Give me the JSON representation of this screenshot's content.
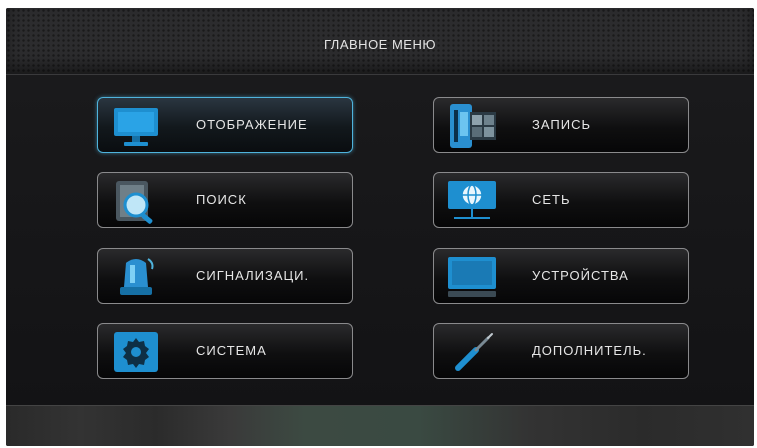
{
  "header": {
    "title": "ГЛАВНОЕ МЕНЮ"
  },
  "menu": {
    "items": [
      {
        "label": "ОТОБРАЖЕНИЕ",
        "icon": "monitor-icon",
        "selected": true
      },
      {
        "label": "ЗАПИСЬ",
        "icon": "film-icon",
        "selected": false
      },
      {
        "label": "ПОИСК",
        "icon": "magnifier-icon",
        "selected": false
      },
      {
        "label": "СЕТЬ",
        "icon": "network-globe-icon",
        "selected": false
      },
      {
        "label": "СИГНАЛИЗАЦИ.",
        "icon": "alarm-beacon-icon",
        "selected": false
      },
      {
        "label": "УСТРОЙСТВА",
        "icon": "device-monitor-icon",
        "selected": false
      },
      {
        "label": "СИСТЕМА",
        "icon": "gear-icon",
        "selected": false
      },
      {
        "label": "ДОПОЛНИТЕЛЬ.",
        "icon": "screwdriver-icon",
        "selected": false
      }
    ]
  },
  "colors": {
    "accent": "#4fb3dc",
    "icon_blue": "#1e8fd0",
    "background": "#141416"
  }
}
